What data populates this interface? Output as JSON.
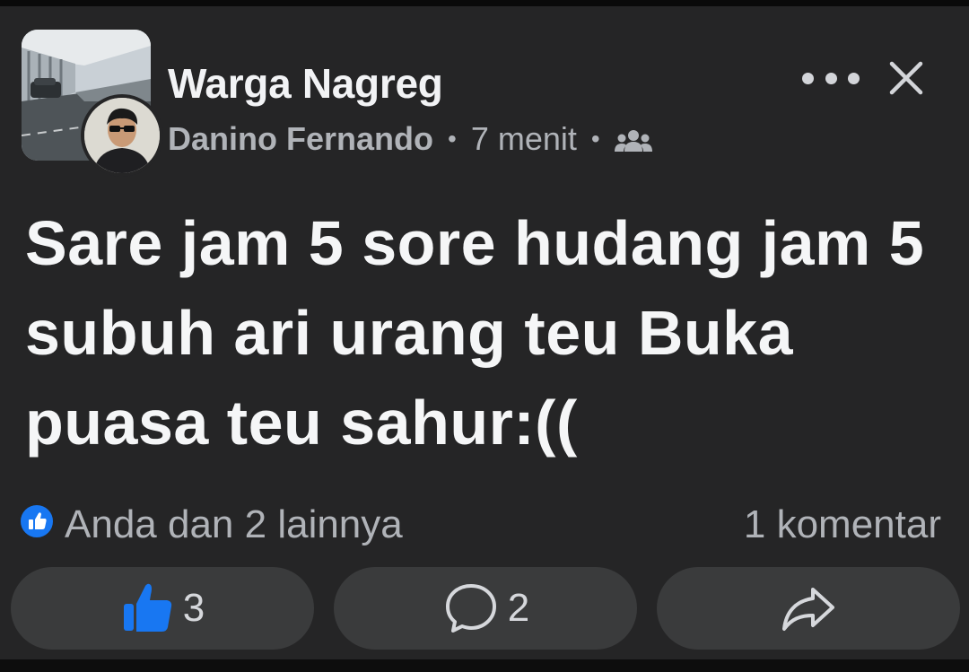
{
  "post": {
    "group_name": "Warga Nagreg",
    "author": "Danino Fernando",
    "separator": "•",
    "time_ago": "7 menit",
    "audience_icon": "group-members-icon",
    "text": "Sare jam 5 sore hudang jam 5 subuh ari urang teu Buka puasa teu sahur:(("
  },
  "header_actions": {
    "more_icon": "more-dots-icon",
    "close_icon": "close-icon"
  },
  "reactions_summary": {
    "icon": "like-badge-icon",
    "text": "Anda dan 2 lainnya",
    "comments": "1 komentar"
  },
  "actions": {
    "like_count": "3",
    "comment_count": "2",
    "share_icon": "share-icon"
  },
  "colors": {
    "background": "#252526",
    "button_background": "#3a3b3c",
    "accent_blue": "#1877f2",
    "primary_text": "#f5f6f7",
    "secondary_text": "#b0b3b8"
  }
}
